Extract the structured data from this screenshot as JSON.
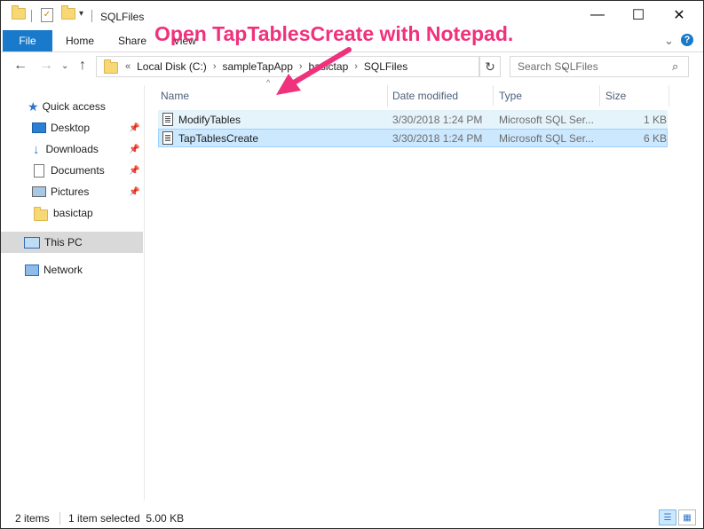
{
  "window": {
    "title": "SQLFiles",
    "controls": {
      "minimize": "—",
      "maximize": "☐",
      "close": "✕"
    }
  },
  "ribbon": {
    "tabs": [
      "File",
      "Home",
      "Share",
      "View"
    ],
    "expand_icon": "chevron-down-icon",
    "help": "?"
  },
  "address": {
    "overflow": "«",
    "segments": [
      "Local Disk (C:)",
      "sampleTapApp",
      "basictap",
      "SQLFiles"
    ],
    "search_placeholder": "Search SQLFiles"
  },
  "nav": {
    "items": [
      {
        "label": "Quick access",
        "icon": "star-icon"
      },
      {
        "label": "Desktop",
        "icon": "desktop-icon",
        "pinned": true
      },
      {
        "label": "Downloads",
        "icon": "download-icon",
        "pinned": true
      },
      {
        "label": "Documents",
        "icon": "documents-icon",
        "pinned": true
      },
      {
        "label": "Pictures",
        "icon": "pictures-icon",
        "pinned": true
      },
      {
        "label": "basictap",
        "icon": "folder-icon"
      },
      {
        "label": "This PC",
        "icon": "computer-icon",
        "selected": true
      },
      {
        "label": "Network",
        "icon": "network-icon"
      }
    ]
  },
  "columns": [
    "Name",
    "Date modified",
    "Type",
    "Size"
  ],
  "files": [
    {
      "name": "ModifyTables",
      "date": "3/30/2018 1:24 PM",
      "type": "Microsoft SQL Ser...",
      "size": "1 KB"
    },
    {
      "name": "TapTablesCreate",
      "date": "3/30/2018 1:24 PM",
      "type": "Microsoft SQL Ser...",
      "size": "6 KB"
    }
  ],
  "status": {
    "count": "2 items",
    "selection": "1 item selected  5.00 KB"
  },
  "annotation": {
    "text": "Open TapTablesCreate with Notepad.",
    "color": "#f0317c"
  },
  "colors": {
    "accent": "#1979ca",
    "selection": "#cce8ff",
    "hover": "#e5f3fb"
  }
}
